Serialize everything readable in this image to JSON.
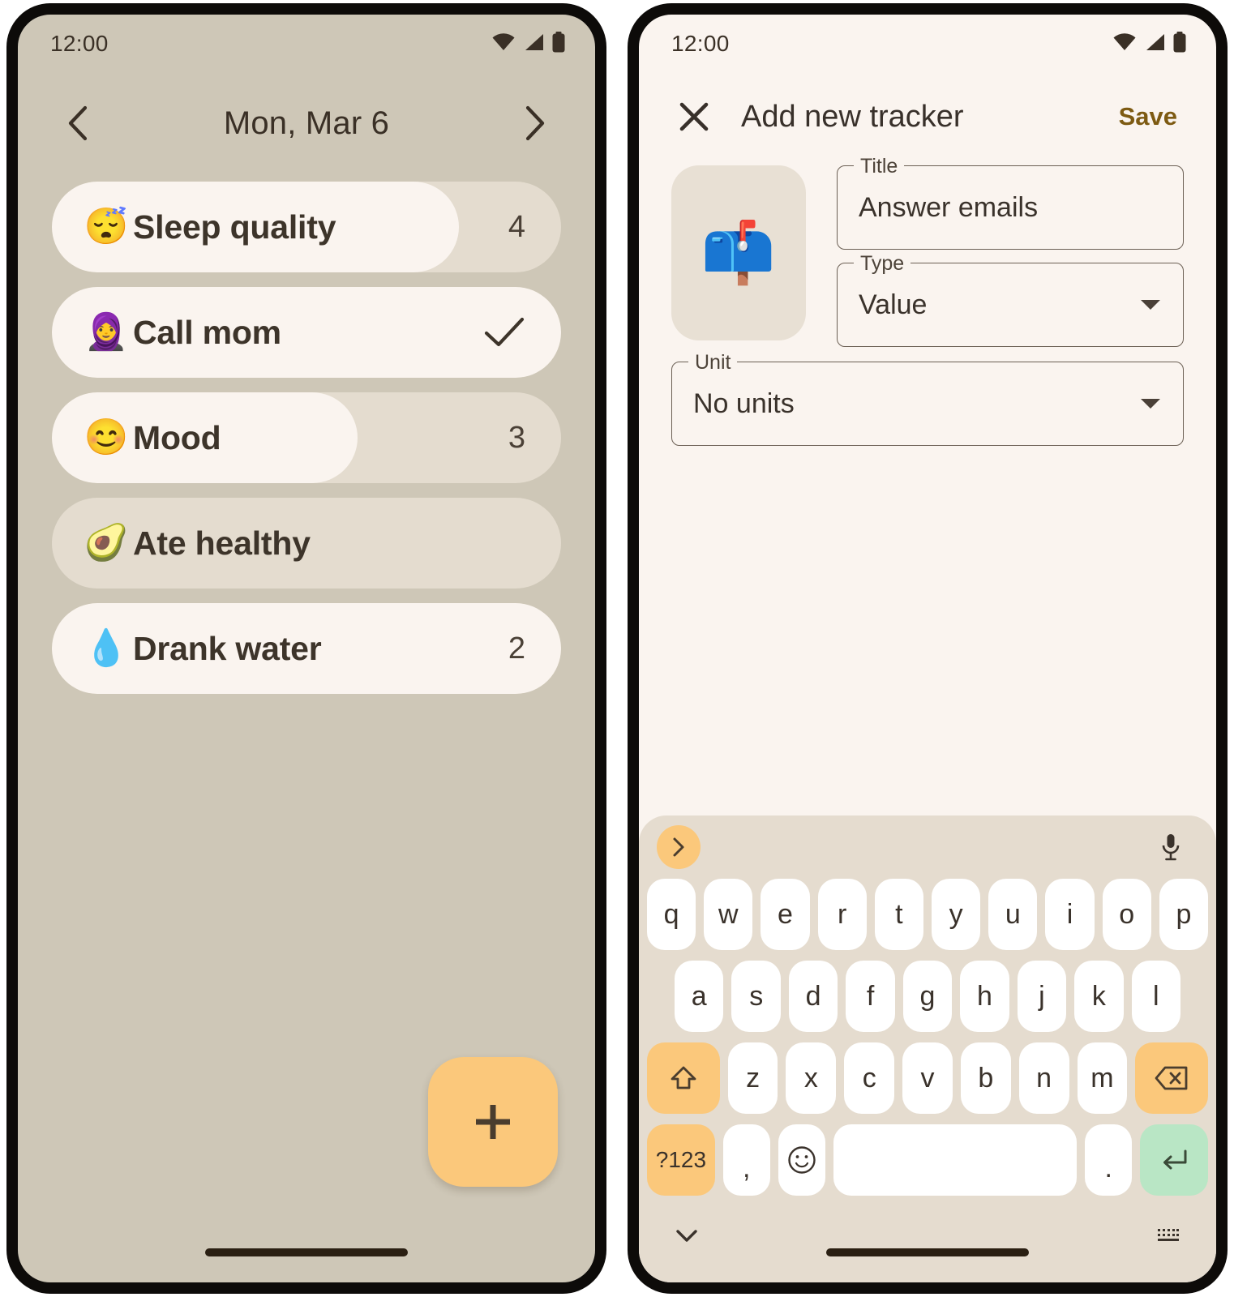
{
  "colors": {
    "left_bg": "#cec7b7",
    "right_bg": "#faf4ef",
    "row_track": "#e4dccf",
    "row_fill": "#faf4ef",
    "accent_orange": "#fbc87b",
    "enter_green": "#b9e6c5",
    "text_dark": "#3a3026",
    "save_amber": "#7d5a12",
    "keyboard_bg": "#e5dccf"
  },
  "left_phone": {
    "status_bar": {
      "time": "12:00",
      "icons": [
        "wifi-icon",
        "cellular-signal-icon",
        "battery-icon"
      ]
    },
    "date_header": {
      "prev_icon": "chevron-left-icon",
      "title": "Mon, Mar 6",
      "next_icon": "chevron-right-icon"
    },
    "trackers": [
      {
        "emoji": "😴",
        "emoji_name": "sleeping-face-emoji",
        "label": "Sleep quality",
        "value": "4",
        "kind": "value",
        "fill_pct": 80
      },
      {
        "emoji": "🧕",
        "emoji_name": "woman-with-headscarf-emoji",
        "label": "Call mom",
        "value": "✓",
        "kind": "check",
        "fill_pct": 100
      },
      {
        "emoji": "😊",
        "emoji_name": "smiling-face-emoji",
        "label": "Mood",
        "value": "3",
        "kind": "value",
        "fill_pct": 60
      },
      {
        "emoji": "🥑",
        "emoji_name": "avocado-emoji",
        "label": "Ate healthy",
        "value": "",
        "kind": "unchecked",
        "fill_pct": 0
      },
      {
        "emoji": "💧",
        "emoji_name": "droplet-emoji",
        "label": "Drank water",
        "value": "2",
        "kind": "value",
        "fill_pct": 100
      }
    ],
    "fab": {
      "icon": "plus-icon",
      "label": "+"
    }
  },
  "right_phone": {
    "status_bar": {
      "time": "12:00",
      "icons": [
        "wifi-icon",
        "cellular-signal-icon",
        "battery-icon"
      ]
    },
    "app_bar": {
      "close_icon": "close-icon",
      "title": "Add new tracker",
      "save_label": "Save"
    },
    "form": {
      "emoji_picker": {
        "emoji": "📫",
        "emoji_name": "mailbox-with-raised-flag-emoji"
      },
      "title_field": {
        "label": "Title",
        "value": "Answer emails",
        "placeholder": "Title"
      },
      "type_field": {
        "label": "Type",
        "value": "Value",
        "caret_icon": "chevron-down-icon"
      },
      "unit_field": {
        "label": "Unit",
        "value": "No units",
        "caret_icon": "chevron-down-icon"
      }
    },
    "keyboard": {
      "suggest_bar": {
        "expand_icon": "chevron-right-icon",
        "mic_icon": "microphone-icon"
      },
      "row1": [
        "q",
        "w",
        "e",
        "r",
        "t",
        "y",
        "u",
        "i",
        "o",
        "p"
      ],
      "row2": [
        "a",
        "s",
        "d",
        "f",
        "g",
        "h",
        "j",
        "k",
        "l"
      ],
      "row3": {
        "shift": {
          "icon": "shift-arrow-icon",
          "label": "⇧"
        },
        "letters": [
          "z",
          "x",
          "c",
          "v",
          "b",
          "n",
          "m"
        ],
        "backspace": {
          "icon": "backspace-icon",
          "label": "⌫"
        }
      },
      "row4": {
        "symbols": "?123",
        "comma": ",",
        "emoji_key": {
          "icon": "emoji-smiley-icon",
          "label": "☺"
        },
        "space": "",
        "period": ".",
        "enter": {
          "icon": "enter-return-icon",
          "label": "↵"
        }
      },
      "bottom_bar": {
        "hide_icon": "chevron-down-icon",
        "switch_icon": "keyboard-switcher-icon"
      }
    }
  }
}
